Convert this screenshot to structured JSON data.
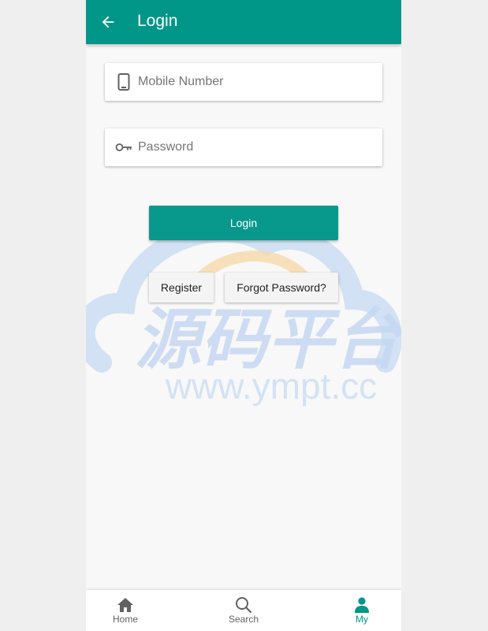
{
  "app_bar": {
    "title": "Login",
    "back_icon": "arrow-left-icon",
    "color": "#009688"
  },
  "form": {
    "mobile": {
      "placeholder": "Mobile Number",
      "value": "",
      "icon": "smartphone-icon"
    },
    "password": {
      "placeholder": "Password",
      "value": "",
      "icon": "key-icon"
    },
    "login_label": "Login",
    "register_label": "Register",
    "forgot_label": "Forgot Password?"
  },
  "watermark": {
    "title": "源码平台",
    "url": "www.ympt.cc"
  },
  "bottom_nav": {
    "active": "My",
    "active_color": "#009688",
    "inactive_color": "#616161",
    "items": [
      {
        "label": "Home",
        "icon": "home-icon"
      },
      {
        "label": "Search",
        "icon": "search-icon"
      },
      {
        "label": "My",
        "icon": "person-icon"
      }
    ]
  }
}
